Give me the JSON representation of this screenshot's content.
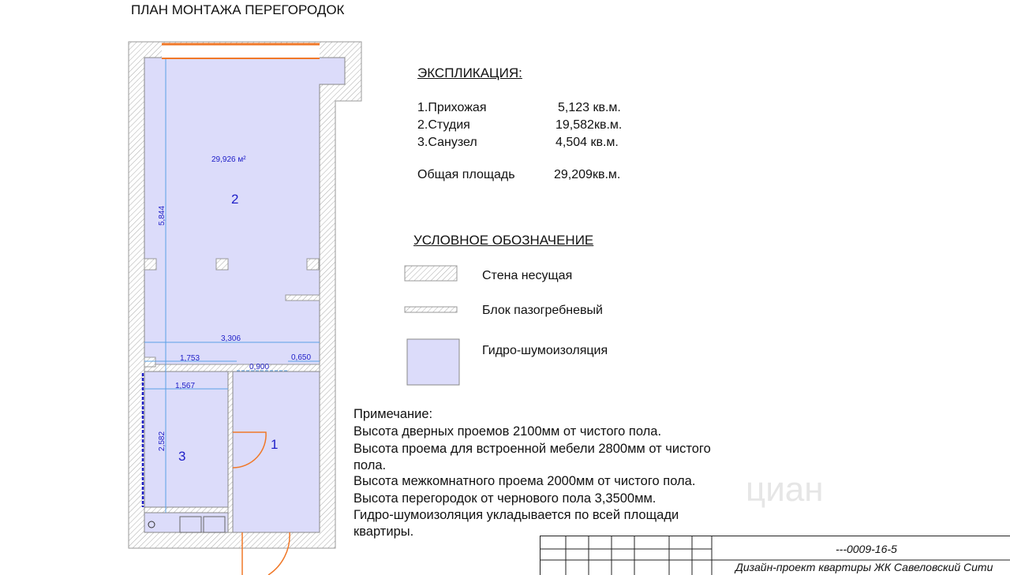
{
  "title": "ПЛАН МОНТАЖА ПЕРЕГОРОДОК",
  "plan": {
    "room_area": "29,926 м²",
    "rooms": [
      "1",
      "2",
      "3"
    ],
    "dims": {
      "height_studio": "5,844",
      "width_total": "3,306",
      "w1": "1,753",
      "w2": "0,900",
      "w3": "0,650",
      "w_bath": "1,567",
      "h_bath": "2,582"
    }
  },
  "explication": {
    "heading": "ЭКСПЛИКАЦИЯ:",
    "rows": [
      {
        "name": "1.Прихожая",
        "area": "5,123 кв.м."
      },
      {
        "name": "2.Студия",
        "area": "19,582кв.м."
      },
      {
        "name": "3.Санузел",
        "area": "4,504 кв.м."
      }
    ],
    "total_label": "Общая площадь",
    "total_value": "29,209кв.м."
  },
  "legend": {
    "heading": "УСЛОВНОЕ ОБОЗНАЧЕНИЕ",
    "items": [
      "Стена несущая",
      "Блок пазогребневый",
      "Гидро-шумоизоляция"
    ]
  },
  "notes": {
    "heading": "Примечание:",
    "lines": [
      "Высота дверных проемов 2100мм от чистого пола.",
      "Высота проема для встроенной мебели 2800мм от чистого",
      "пола.",
      "Высота межкомнатного проема 2000мм от чистого пола.",
      "Высота перегородок от чернового пола 3,3500мм.",
      "Гидро-шумоизоляция укладывается по всей площади",
      "квартиры."
    ]
  },
  "titleblock": {
    "code": "---0009-16-5",
    "project": "Дизайн-проект квартиры ЖК Савеловский Сити"
  },
  "watermark": "циан",
  "colors": {
    "fill": "#dcdcfa",
    "dim": "#5aa0e6",
    "text_blue": "#2020c8",
    "orange": "#f07828"
  }
}
